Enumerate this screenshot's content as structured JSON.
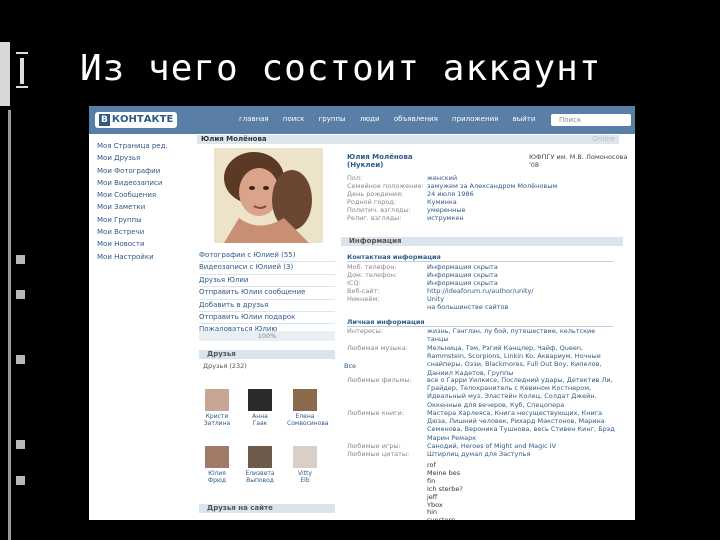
{
  "slide": {
    "title": "Из чего состоит аккаунт"
  },
  "header": {
    "logo_badge": "В",
    "logo_text": "КОНТАКТЕ",
    "nav": [
      "главная",
      "поиск",
      "группы",
      "люди",
      "объявления",
      "приложения",
      "выйти"
    ],
    "search_placeholder": "Поиск"
  },
  "menu": [
    "Моя Страница ред.",
    "Мои Друзья",
    "Мои Фотографии",
    "Мои Видеозаписи",
    "Мои Сообщения",
    "Мои Заметки",
    "Мои Группы",
    "Мои Встречи",
    "Мои Новости",
    "Мои Настройки"
  ],
  "profile": {
    "header_name": "Юлия Молёнова",
    "online": "Online",
    "full_name": "Юлия Молёнова",
    "nickname": "(Нуклеи)",
    "university": "ЮФПГУ им. М.В. Ломоносова '08",
    "basic": [
      {
        "k": "Пол:",
        "v": "женский"
      },
      {
        "k": "Семейное положение:",
        "v": "замужем за Александром Молёновым"
      },
      {
        "k": "День рождения:",
        "v": "24 июля 1986"
      },
      {
        "k": "Родной город:",
        "v": "Куминка"
      },
      {
        "k": "Политич. взгляды:",
        "v": "умеренные"
      },
      {
        "k": "Религ. взгляды:",
        "v": "иструмкен"
      }
    ],
    "photo_links": [
      "Фотографии с Юлией (55)",
      "Видеозаписи с Юлией (3)",
      "Друзья Юлии",
      "Отправить Юлии сообщение",
      "Добавить в друзья",
      "Отправить Юлии подарок",
      "Пожаловаться Юлию"
    ],
    "completion": "100%"
  },
  "friends": {
    "title": "Друзья",
    "count": "Друзья (232)",
    "all": "Все",
    "items": [
      {
        "first": "Кристи",
        "last": "Затлина"
      },
      {
        "first": "Анна",
        "last": "Гаак"
      },
      {
        "first": "Елена",
        "last": "Сомвосинова"
      },
      {
        "first": "Юлия",
        "last": "Фрюд"
      },
      {
        "first": "Елизвета",
        "last": "Выповод"
      },
      {
        "first": "Vitty",
        "last": "Elb"
      }
    ],
    "online_title": "Друзья на сайте"
  },
  "info": {
    "title": "Информация",
    "contact_title": "Контактная информация",
    "contact": [
      {
        "k": "Моб. телефон:",
        "v": "Информация скрыта"
      },
      {
        "k": "Дом. телефон:",
        "v": "Информация скрыта"
      },
      {
        "k": "ICQ:",
        "v": "Информация скрыта"
      },
      {
        "k": "Веб-сайт:",
        "v": "http://ideaforum.ru/author/unity/"
      },
      {
        "k": "Никнейм:",
        "v": "Unity"
      },
      {
        "k": "",
        "v": "на большинстве сайтов"
      }
    ],
    "personal_title": "Личная информация",
    "interests_k": "Интересы:",
    "interests": "жизнь, Гэнглэн, лу бой, путешествие, кельтские танцы",
    "music_k": "Любимая музыка:",
    "music": "Мельница, Тэм, Рэгий Канцлер, Чайф, Queen, Rammstein, Scorpions, Linkin Ko, Аквариум, Ночные снайперы, Оззи, Blackmores, Full Out Boy, Кипелов, Даниил Кадетов, Группы",
    "movies_k": "Любимые фильмы:",
    "movies": "все о Гарри Уилкисе, Последний удары, Детектив Ли, Грайдер, Телохранитель с Кевином Костнером, Идеальный муз, Эластейн Колец, Солдат Джейн, Оккенные для вечеров, Куб, Спецопера",
    "books_k": "Любимые книги:",
    "books": "Мастера Харлеяса, Книга несуществующих, Книга Дюза, Лишний человек, Рихард Макстонов, Марина Семенова, Вероника Тушнова, весь Стивен Кинг, Брэд Марин Ремарк",
    "games_k": "Любимые игры:",
    "games": "Санодий, Heroes of Might and Magic IV",
    "quotes_k": "Любимые цитаты:",
    "quotes": "Штирлиц думал для Заступья",
    "extra": [
      "rof",
      "Meine bes",
      "fin",
      "Ich sterbe?",
      "jeff",
      "Ybox",
      "hin",
      "sunstern"
    ]
  }
}
